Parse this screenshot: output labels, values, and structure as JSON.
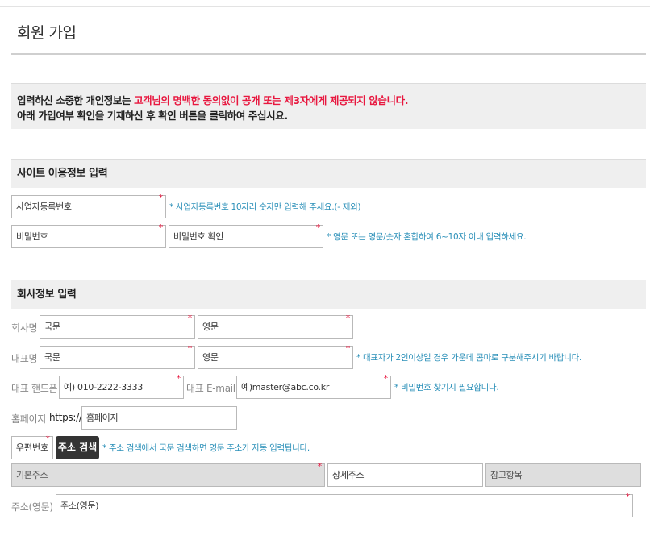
{
  "page": {
    "title": "회원 가입"
  },
  "notice": {
    "line1_prefix": "입력하신 소중한 개인정보는 ",
    "line1_highlight": "고객님의 명백한 동의없이 공개 또는 제3자에게 제공되지 않습니다.",
    "line2": "아래 가입여부 확인을 기재하신 후 확인 버튼을 클릭하여 주십시요."
  },
  "site_section": {
    "title": "사이트 이용정보 입력",
    "business_number": {
      "placeholder": "사업자등록번호",
      "value": ""
    },
    "business_hint": "* 사업자등록번호 10자리 숫자만 입력해 주세요.(- 제외)",
    "password": {
      "placeholder": "비밀번호",
      "value": ""
    },
    "password_confirm": {
      "placeholder": "비밀번호 확인",
      "value": ""
    },
    "password_hint": "* 영문 또는 영문/숫자 혼합하여 6~10자 이내 입력하세요."
  },
  "company_section": {
    "title": "회사정보 입력",
    "company_name_label": "회사명",
    "company_name_ko": {
      "placeholder": "국문",
      "value": ""
    },
    "company_name_en": {
      "placeholder": "영문",
      "value": ""
    },
    "ceo_label": "대표명",
    "ceo_ko": {
      "placeholder": "국문",
      "value": ""
    },
    "ceo_en": {
      "placeholder": "영문",
      "value": ""
    },
    "ceo_hint": "* 대표자가 2인이상일 경우 가운데 콤마로 구분해주시기 바랍니다.",
    "phone_label": "대표 핸드폰",
    "phone": {
      "placeholder": "예) 010-2222-3333",
      "value": ""
    },
    "email_label": "대표 E-mail",
    "email": {
      "placeholder": "예)master@abc.co.kr",
      "value": ""
    },
    "email_hint": "* 비밀번호 찾기시 필요합니다.",
    "homepage_label": "홈페이지",
    "homepage_prefix": "https://",
    "homepage": {
      "placeholder": "홈페이지",
      "value": ""
    },
    "postal_button": "우편번호",
    "address_search_button": "주소 검색",
    "address_hint": "* 주소 검색에서 국문 검색하면 영문 주소가 자동 입력됩니다.",
    "base_address": {
      "placeholder": "기본주소",
      "value": ""
    },
    "detail_address": {
      "placeholder": "상세주소",
      "value": ""
    },
    "reference": {
      "placeholder": "참고항목",
      "value": ""
    },
    "address_en_label": "주소(영문)",
    "address_en": {
      "placeholder": "주소(영문)",
      "value": ""
    }
  },
  "required_mark": "*",
  "colors": {
    "accent_red": "#e8173f",
    "hint_blue": "#2a8fb8",
    "button_dark": "#333333"
  }
}
